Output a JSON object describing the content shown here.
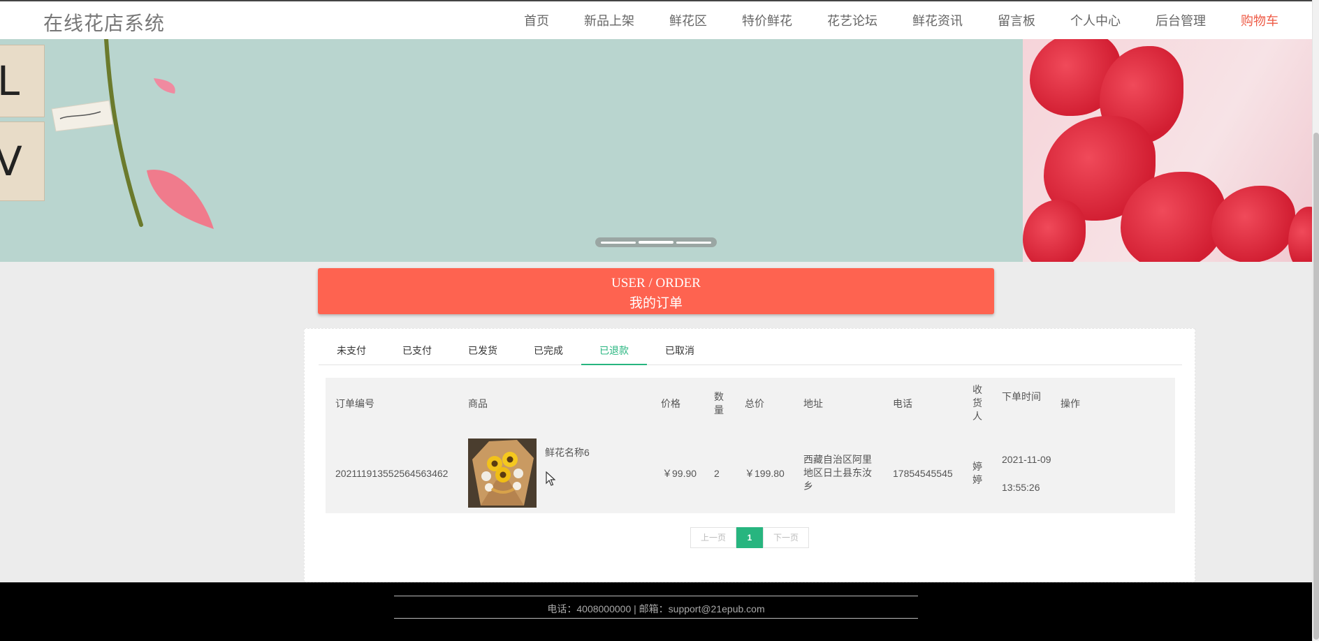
{
  "header": {
    "logo": "在线花店系统",
    "nav": [
      "首页",
      "新品上架",
      "鲜花区",
      "特价鲜花",
      "花艺论坛",
      "鲜花资讯",
      "留言板",
      "个人中心",
      "后台管理"
    ],
    "cart": "购物车",
    "cart_color": "#ee5a45"
  },
  "banner": {
    "tile_letters": [
      "L",
      "V"
    ],
    "slide_count": 3,
    "active_slide": 2
  },
  "order_title": {
    "en": "USER / ORDER",
    "zh": "我的订单",
    "color": "#fe6350"
  },
  "tabs": {
    "items": [
      "未支付",
      "已支付",
      "已发货",
      "已完成",
      "已退款",
      "已取消"
    ],
    "active": "已退款",
    "accent": "#27b57f"
  },
  "table": {
    "headers": {
      "order_no": "订单编号",
      "goods": "商品",
      "price": "价格",
      "qty": "数量",
      "total": "总价",
      "address": "地址",
      "phone": "电话",
      "receiver": "收货人",
      "time": "下单时间",
      "action": "操作"
    },
    "rows": [
      {
        "order_no": "20211191355256456346 2",
        "goods_name": "鲜花名称6",
        "price": "￥99.90",
        "qty": "2",
        "total": "￥199.80",
        "address": "西藏自治区阿里地区日土县东汝乡",
        "phone": "17854545545",
        "receiver": "婷婷",
        "time_date": "2021-11-09",
        "time_clock": "13:55:26"
      }
    ]
  },
  "pager": {
    "prev": "上一页",
    "current": "1",
    "next": "下一页"
  },
  "footer": {
    "text": "电话：4008000000 | 邮箱：support@21epub.com"
  }
}
